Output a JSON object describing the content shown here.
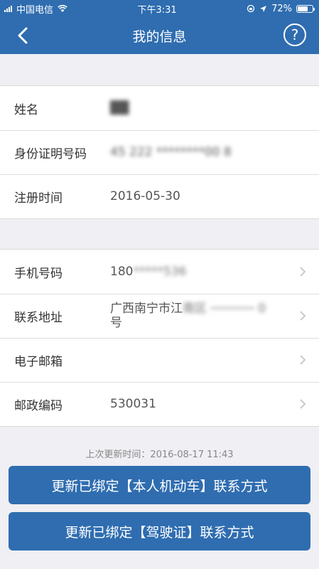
{
  "status_bar": {
    "carrier": "中国电信",
    "time": "下午3:31",
    "battery": "72%",
    "battery_level": 0.72
  },
  "nav": {
    "title": "我的信息",
    "back_icon": "chevron-left-icon",
    "help_label": "?"
  },
  "personal": [
    {
      "label": "姓名",
      "value": "██"
    },
    {
      "label": "身份证明号码",
      "value": "45 222 ********00 8"
    },
    {
      "label": "注册时间",
      "value": "2016-05-30"
    }
  ],
  "contact": [
    {
      "label": "手机号码",
      "value_visible": "180",
      "value_hidden": "*****536"
    },
    {
      "label": "联系地址",
      "value_visible": "广西南宁市江",
      "value_hidden": "南区 ────── 0",
      "value_line2": "号"
    },
    {
      "label": "电子邮箱",
      "value": ""
    },
    {
      "label": "邮政编码",
      "value": "530031"
    }
  ],
  "footer": {
    "update_time": "上次更新时间：2016-08-17 11:43",
    "button_vehicle": "更新已绑定【本人机动车】联系方式",
    "button_license": "更新已绑定【驾驶证】联系方式"
  },
  "colors": {
    "primary": "#2f6db0",
    "background": "#efeff4"
  }
}
